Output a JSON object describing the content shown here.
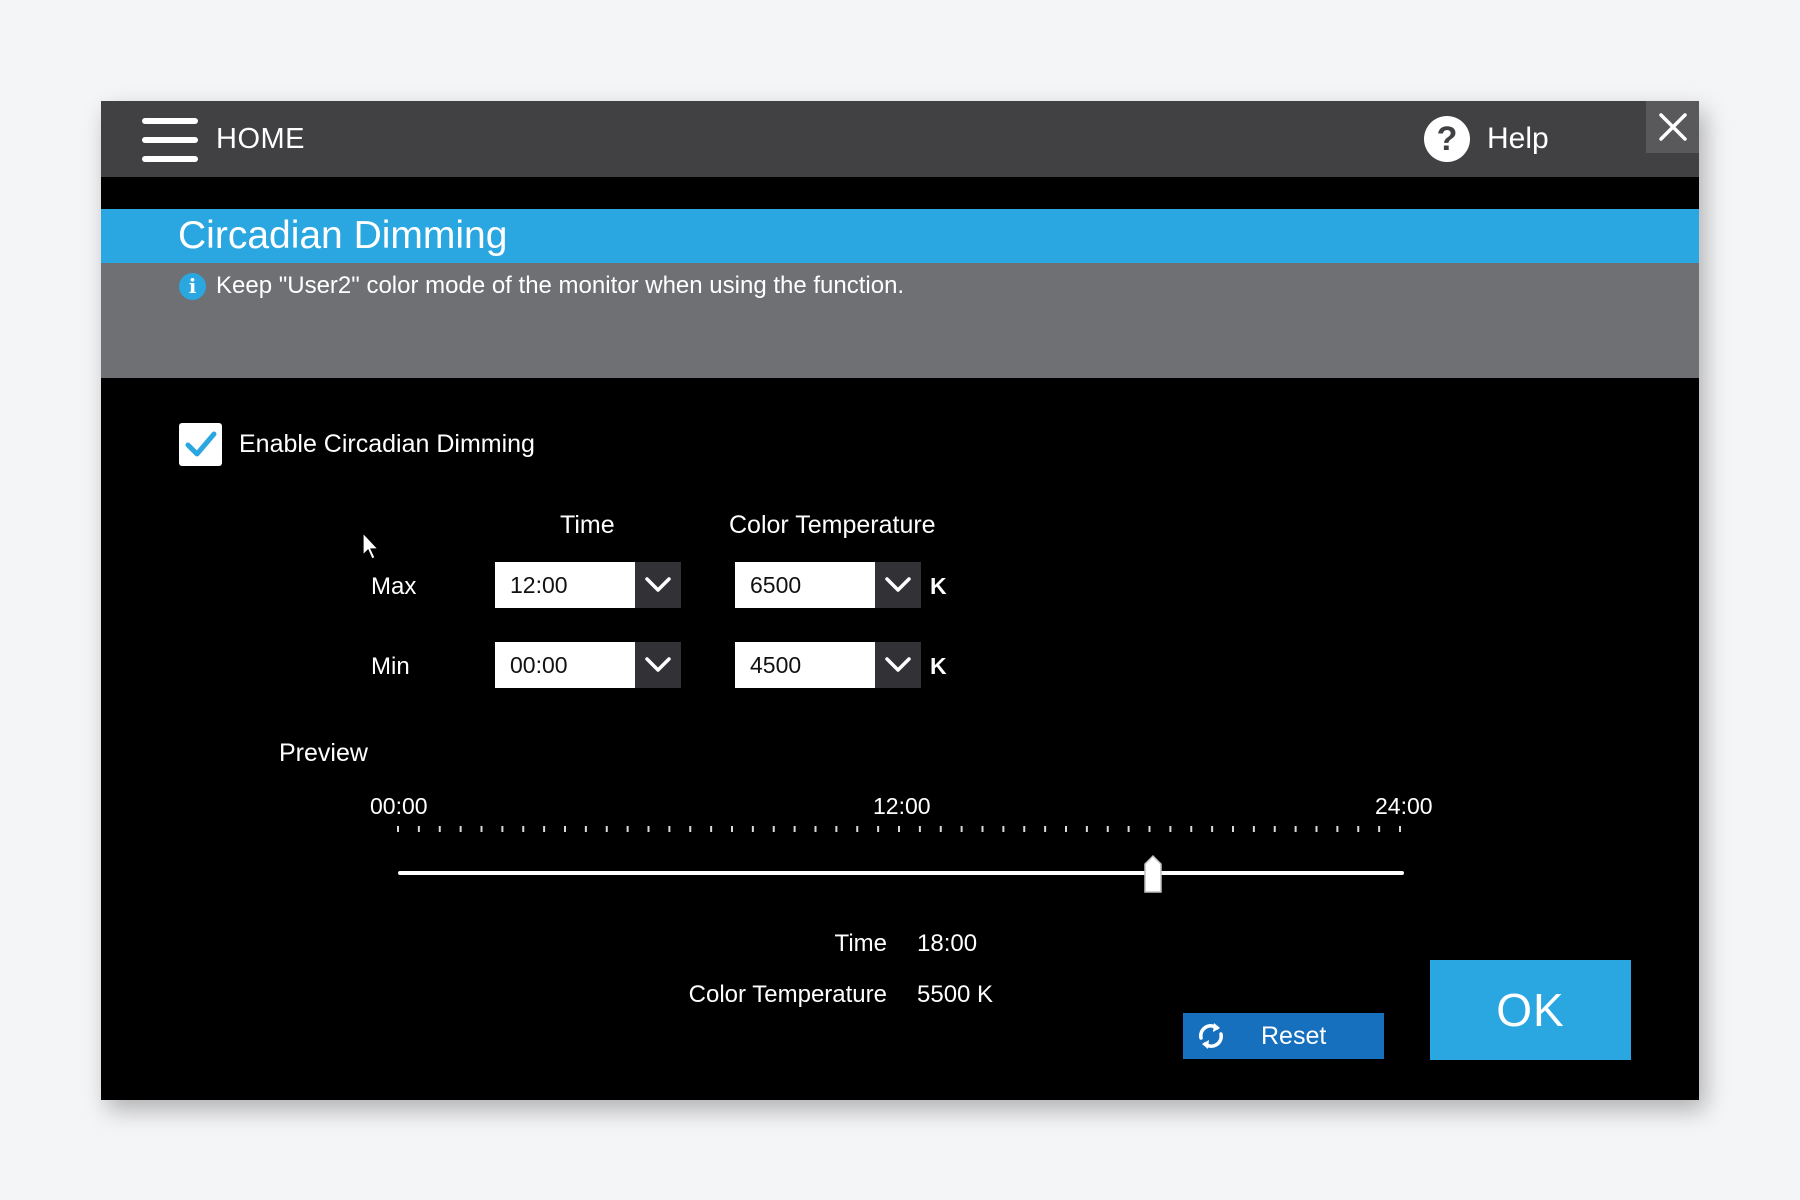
{
  "header": {
    "menu_icon": "hamburger-menu-icon",
    "home_label": "HOME",
    "help_icon": "question-circle-icon",
    "help_label": "Help",
    "close_icon": "close-x-icon"
  },
  "page": {
    "title": "Circadian Dimming",
    "info_icon": "info-icon",
    "info_text": "Keep \"User2\" color mode of the monitor when using the function.",
    "accent_color": "#2aa7e1"
  },
  "enable": {
    "label": "Enable Circadian Dimming",
    "checked": true
  },
  "settings": {
    "time_header": "Time",
    "color_temp_header": "Color Temperature",
    "unit": "K",
    "rows": [
      {
        "label": "Max",
        "time": "12:00",
        "color_temp": "6500"
      },
      {
        "label": "Min",
        "time": "00:00",
        "color_temp": "4500"
      }
    ]
  },
  "preview": {
    "label": "Preview",
    "axis_labels": [
      "00:00",
      "12:00",
      "24:00"
    ],
    "slider_fraction": 0.75,
    "time_label": "Time",
    "time_value": "18:00",
    "color_temp_label": "Color Temperature",
    "color_temp_value": "5500 K"
  },
  "buttons": {
    "reset_icon": "refresh-icon",
    "reset_label": "Reset",
    "ok_label": "OK"
  }
}
